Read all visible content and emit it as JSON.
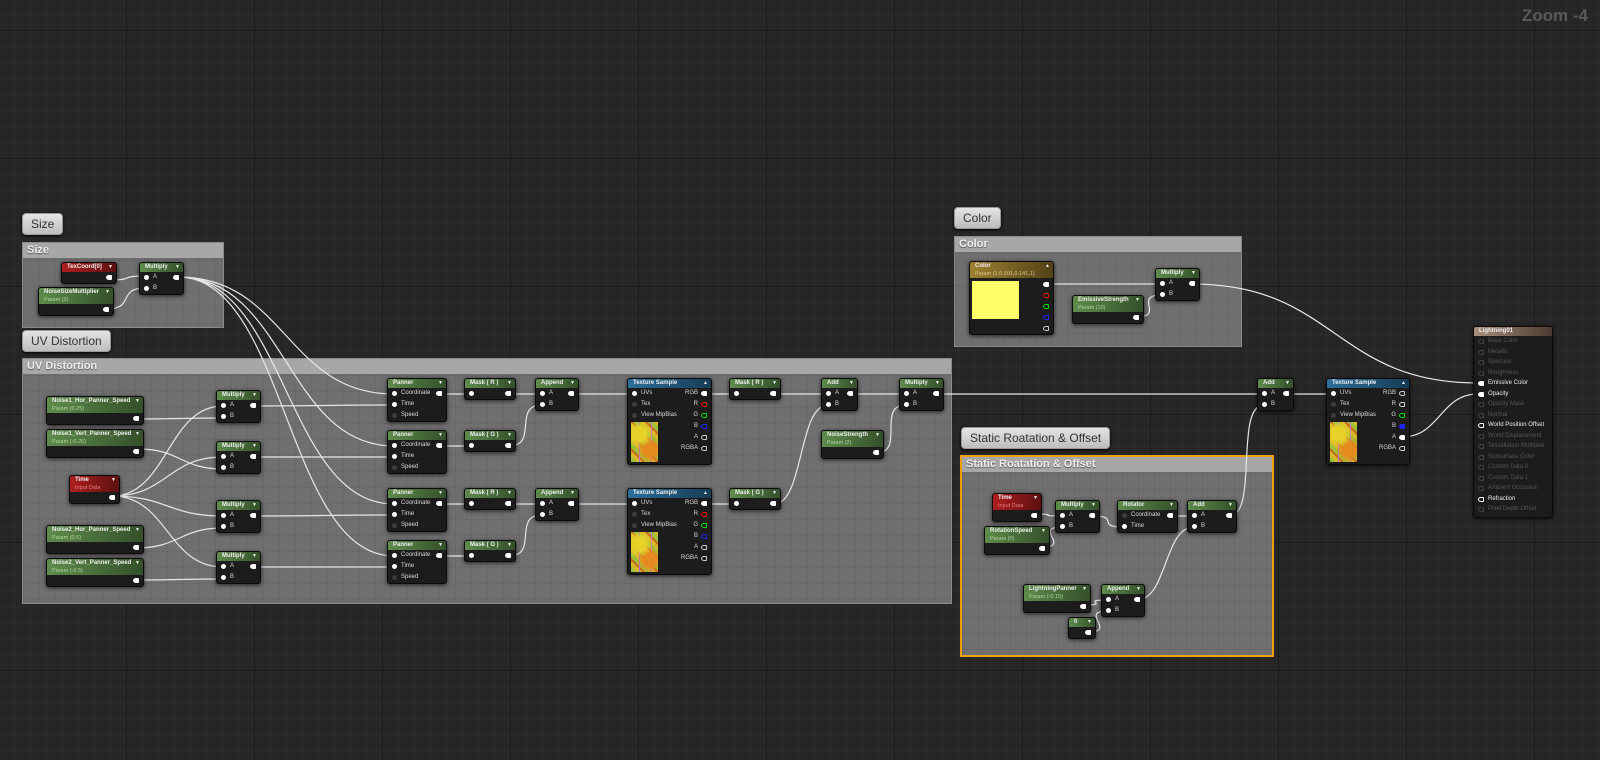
{
  "zoom_label": "Zoom -4",
  "comments": {
    "size": "Size",
    "uv": "UV Distortion",
    "color": "Color",
    "static": "Static Roatation & Offset"
  },
  "pins": {
    "a": "A",
    "b": "B",
    "coordinate": "Coordinate",
    "time": "Time",
    "speed": "Speed",
    "uvs": "UVs",
    "tex": "Tex",
    "mip": "View MipBias",
    "rgb": "RGB",
    "r": "R",
    "g": "G",
    "bl": "B",
    "al": "A",
    "rgba": "RGBA"
  },
  "nodes": {
    "texcoord": "TexCoord[0]",
    "noise_size": {
      "title": "NoiseSizeMultiplier",
      "sub": "Param (2)"
    },
    "multiply": "Multiply",
    "panner": "Panner",
    "mask_r": "Mask ( R )",
    "mask_g": "Mask ( G )",
    "append": "Append",
    "add": "Add",
    "rotator": "Rotator",
    "texture_sample": "Texture Sample",
    "noise1_hor": {
      "title": "Noise1_Hor_Panner_Speed",
      "sub": "Param (0.25)"
    },
    "noise1_vert": {
      "title": "Noise1_Vert_Panner_Speed",
      "sub": "Param (-0.25)"
    },
    "time": {
      "title": "Time",
      "sub": "Input Data"
    },
    "noise2_hor": {
      "title": "Noise2_Hor_Panner_Speed",
      "sub": "Param (0.5)"
    },
    "noise2_vert": {
      "title": "Noise2_Vert_Panner_Speed",
      "sub": "Param (-0.5)"
    },
    "noise_strength": {
      "title": "NoiseStrength",
      "sub": "Param (2)"
    },
    "color": {
      "title": "Color",
      "sub": "Param (1,0.991,0.141,1)",
      "swatch": "#fdfd6a"
    },
    "emissive_strength": {
      "title": "EmissiveStrength",
      "sub": "Param (10)"
    },
    "rotation_speed": {
      "title": "RotationSpeed",
      "sub": "Param (0)"
    },
    "lightning_panner": {
      "title": "LightningPanner",
      "sub": "Param (-0.15)"
    },
    "constant": "0"
  },
  "result": {
    "title": "Lightning01",
    "inputs": [
      "Base Color",
      "Metallic",
      "Specular",
      "Roughness",
      "Emissive Color",
      "Opacity",
      "Opacity Mask",
      "Normal",
      "World Position Offset",
      "World Displacement",
      "Tessellation Multiplier",
      "Subsurface Color",
      "Custom Data 0",
      "Custom Data 1",
      "Ambient Occlusion",
      "Refraction",
      "Pixel Depth Offset"
    ]
  },
  "colors": {
    "selection": "#f0a000",
    "wire": "#e6e6e6"
  }
}
